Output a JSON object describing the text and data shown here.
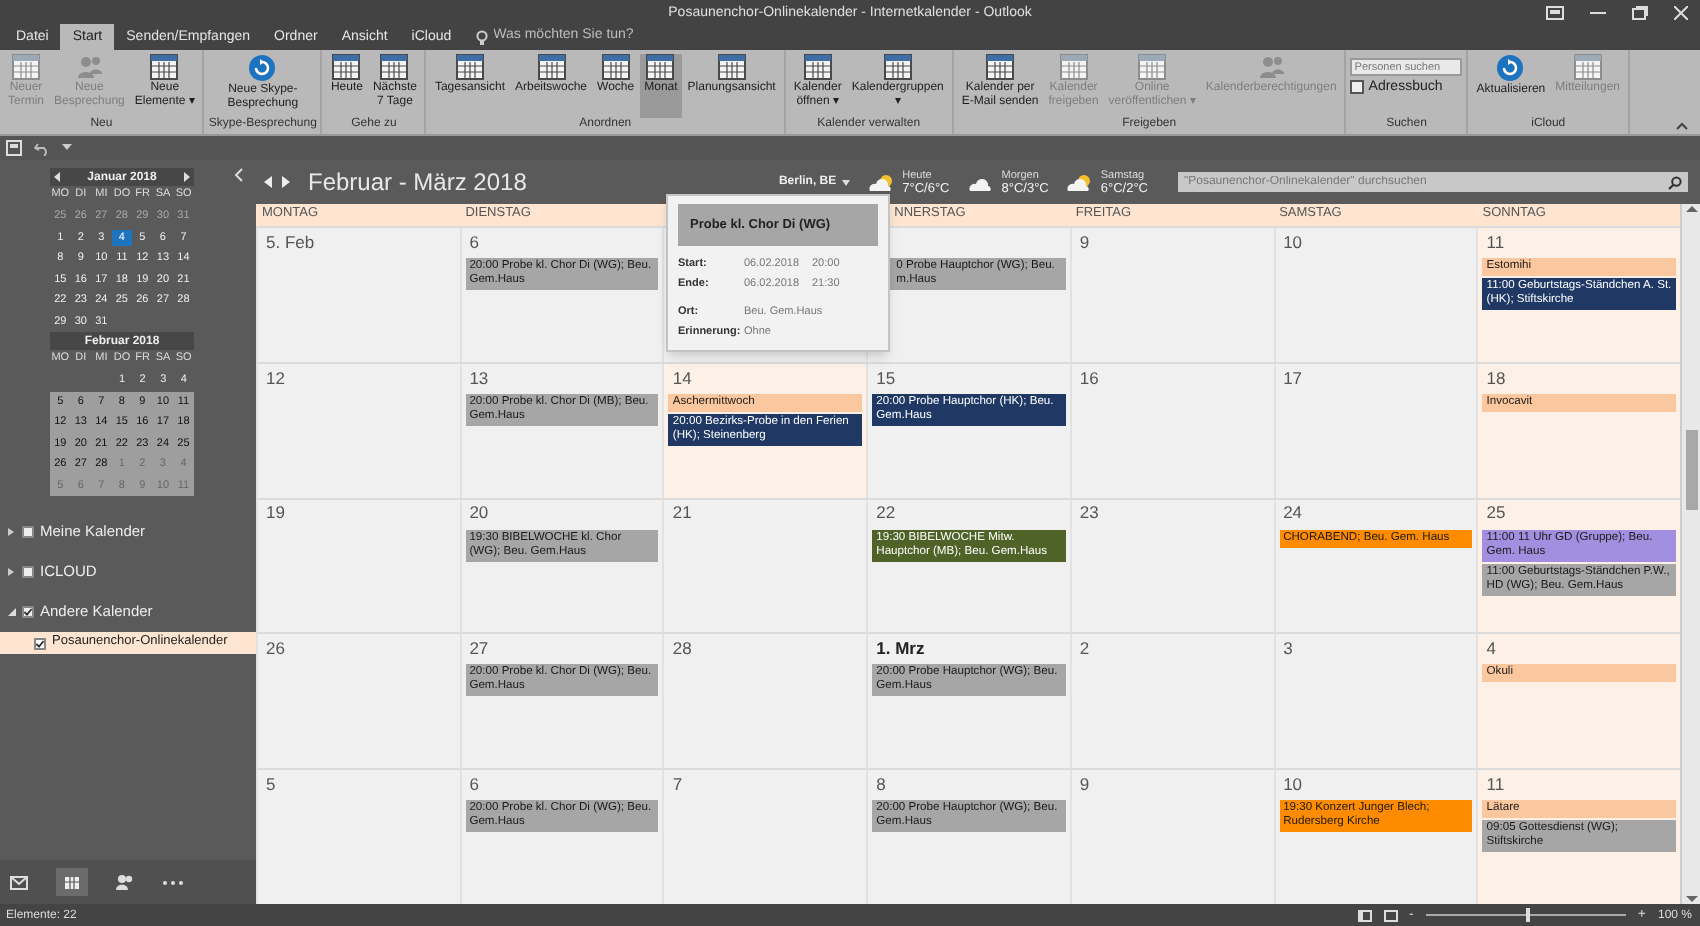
{
  "window": {
    "title": "Posaunenchor-Onlinekalender - Internetkalender - Outlook"
  },
  "tabs": [
    {
      "label": "Datei",
      "selected": false
    },
    {
      "label": "Start",
      "selected": true
    },
    {
      "label": "Senden/Empfangen",
      "selected": false
    },
    {
      "label": "Ordner",
      "selected": false
    },
    {
      "label": "Ansicht",
      "selected": false
    },
    {
      "label": "iCloud",
      "selected": false
    }
  ],
  "tell_me": {
    "placeholder": "Was möchten Sie tun?"
  },
  "ribbon": [
    {
      "group": "Neu",
      "buttons": [
        {
          "label": "Neuer\nTermin",
          "kind": "grid",
          "disabled": true,
          "selected": false
        },
        {
          "label": "Neue\nBesprechung",
          "kind": "people",
          "disabled": true,
          "selected": false
        },
        {
          "label": "Neue\nElemente ▾",
          "kind": "grid",
          "disabled": false,
          "selected": false
        }
      ]
    },
    {
      "group": "Skype-Besprechung",
      "buttons": [
        {
          "label": "Neue Skype-\nBesprechung",
          "kind": "round",
          "disabled": false,
          "selected": false
        }
      ]
    },
    {
      "group": "Gehe zu",
      "buttons": [
        {
          "label": "Heute",
          "kind": "grid",
          "disabled": false,
          "selected": false
        },
        {
          "label": "Nächste\n7 Tage",
          "kind": "grid",
          "disabled": false,
          "selected": false
        }
      ]
    },
    {
      "group": "Anordnen",
      "buttons": [
        {
          "label": "Tagesansicht",
          "kind": "grid",
          "disabled": false,
          "selected": false
        },
        {
          "label": "Arbeitswoche",
          "kind": "grid",
          "disabled": false,
          "selected": false
        },
        {
          "label": "Woche",
          "kind": "grid",
          "disabled": false,
          "selected": false
        },
        {
          "label": "Monat",
          "kind": "grid",
          "disabled": false,
          "selected": true
        },
        {
          "label": "Planungsansicht",
          "kind": "grid",
          "disabled": false,
          "selected": false
        }
      ]
    },
    {
      "group": "Kalender verwalten",
      "buttons": [
        {
          "label": "Kalender\nöffnen ▾",
          "kind": "grid",
          "disabled": false,
          "selected": false
        },
        {
          "label": "Kalendergruppen\n▾",
          "kind": "grid",
          "disabled": false,
          "selected": false
        }
      ]
    },
    {
      "group": "Freigeben",
      "buttons": [
        {
          "label": "Kalender per\nE-Mail senden",
          "kind": "grid",
          "disabled": false,
          "selected": false
        },
        {
          "label": "Kalender\nfreigeben",
          "kind": "grid",
          "disabled": true,
          "selected": false
        },
        {
          "label": "Online\nveröffentlichen ▾",
          "kind": "grid",
          "disabled": true,
          "selected": false
        },
        {
          "label": "Kalenderberechtigungen",
          "kind": "people",
          "disabled": true,
          "selected": false
        }
      ]
    },
    {
      "group": "Suchen",
      "buttons": [
        {
          "placeholder": "Personen suchen",
          "kind": "search"
        },
        {
          "label": "Adressbuch",
          "kind": "small",
          "disabled": false,
          "selected": false
        }
      ]
    },
    {
      "group": "iCloud",
      "buttons": [
        {
          "label": "Aktualisieren",
          "kind": "round",
          "disabled": false,
          "selected": false
        },
        {
          "label": "Mitteilungen",
          "kind": "grid",
          "disabled": true,
          "selected": false
        }
      ]
    }
  ],
  "mini_calendars": [
    {
      "title": "Januar 2018",
      "weekdays": [
        "MO",
        "DI",
        "MI",
        "DO",
        "FR",
        "SA",
        "SO"
      ],
      "weeks": [
        {
          "shaded": false,
          "days": [
            {
              "n": "25",
              "outside": true,
              "today": false
            },
            {
              "n": "26",
              "outside": true,
              "today": false
            },
            {
              "n": "27",
              "outside": true,
              "today": false
            },
            {
              "n": "28",
              "outside": true,
              "today": false
            },
            {
              "n": "29",
              "outside": true,
              "today": false
            },
            {
              "n": "30",
              "outside": true,
              "today": false
            },
            {
              "n": "31",
              "outside": true,
              "today": false
            }
          ]
        },
        {
          "shaded": false,
          "days": [
            {
              "n": "1",
              "outside": false,
              "today": false
            },
            {
              "n": "2",
              "outside": false,
              "today": false
            },
            {
              "n": "3",
              "outside": false,
              "today": false
            },
            {
              "n": "4",
              "outside": false,
              "today": true
            },
            {
              "n": "5",
              "outside": false,
              "today": false
            },
            {
              "n": "6",
              "outside": false,
              "today": false
            },
            {
              "n": "7",
              "outside": false,
              "today": false
            }
          ]
        },
        {
          "shaded": false,
          "days": [
            {
              "n": "8",
              "outside": false,
              "today": false
            },
            {
              "n": "9",
              "outside": false,
              "today": false
            },
            {
              "n": "10",
              "outside": false,
              "today": false
            },
            {
              "n": "11",
              "outside": false,
              "today": false
            },
            {
              "n": "12",
              "outside": false,
              "today": false
            },
            {
              "n": "13",
              "outside": false,
              "today": false
            },
            {
              "n": "14",
              "outside": false,
              "today": false
            }
          ]
        },
        {
          "shaded": false,
          "days": [
            {
              "n": "15",
              "outside": false,
              "today": false
            },
            {
              "n": "16",
              "outside": false,
              "today": false
            },
            {
              "n": "17",
              "outside": false,
              "today": false
            },
            {
              "n": "18",
              "outside": false,
              "today": false
            },
            {
              "n": "19",
              "outside": false,
              "today": false
            },
            {
              "n": "20",
              "outside": false,
              "today": false
            },
            {
              "n": "21",
              "outside": false,
              "today": false
            }
          ]
        },
        {
          "shaded": false,
          "days": [
            {
              "n": "22",
              "outside": false,
              "today": false
            },
            {
              "n": "23",
              "outside": false,
              "today": false
            },
            {
              "n": "24",
              "outside": false,
              "today": false
            },
            {
              "n": "25",
              "outside": false,
              "today": false
            },
            {
              "n": "26",
              "outside": false,
              "today": false
            },
            {
              "n": "27",
              "outside": false,
              "today": false
            },
            {
              "n": "28",
              "outside": false,
              "today": false
            }
          ]
        },
        {
          "shaded": false,
          "days": [
            {
              "n": "29",
              "outside": false,
              "today": false
            },
            {
              "n": "30",
              "outside": false,
              "today": false
            },
            {
              "n": "31",
              "outside": false,
              "today": false
            }
          ]
        }
      ]
    },
    {
      "title": "Februar 2018",
      "weekdays": [
        "MO",
        "DI",
        "MI",
        "DO",
        "FR",
        "SA",
        "SO"
      ],
      "weeks": [
        {
          "shaded": false,
          "days": [
            {
              "n": "1",
              "outside": false,
              "today": false
            },
            {
              "n": "2",
              "outside": false,
              "today": false
            },
            {
              "n": "3",
              "outside": false,
              "today": false
            },
            {
              "n": "4",
              "outside": false,
              "today": false
            }
          ]
        },
        {
          "shaded": true,
          "days": [
            {
              "n": "5",
              "outside": false,
              "today": false
            },
            {
              "n": "6",
              "outside": false,
              "today": false
            },
            {
              "n": "7",
              "outside": false,
              "today": false
            },
            {
              "n": "8",
              "outside": false,
              "today": false
            },
            {
              "n": "9",
              "outside": false,
              "today": false
            },
            {
              "n": "10",
              "outside": false,
              "today": false
            },
            {
              "n": "11",
              "outside": false,
              "today": false
            }
          ]
        },
        {
          "shaded": true,
          "days": [
            {
              "n": "12",
              "outside": false,
              "today": false
            },
            {
              "n": "13",
              "outside": false,
              "today": false
            },
            {
              "n": "14",
              "outside": false,
              "today": false
            },
            {
              "n": "15",
              "outside": false,
              "today": false
            },
            {
              "n": "16",
              "outside": false,
              "today": false
            },
            {
              "n": "17",
              "outside": false,
              "today": false
            },
            {
              "n": "18",
              "outside": false,
              "today": false
            }
          ]
        },
        {
          "shaded": true,
          "days": [
            {
              "n": "19",
              "outside": false,
              "today": false
            },
            {
              "n": "20",
              "outside": false,
              "today": false
            },
            {
              "n": "21",
              "outside": false,
              "today": false
            },
            {
              "n": "22",
              "outside": false,
              "today": false
            },
            {
              "n": "23",
              "outside": false,
              "today": false
            },
            {
              "n": "24",
              "outside": false,
              "today": false
            },
            {
              "n": "25",
              "outside": false,
              "today": false
            }
          ]
        },
        {
          "shaded": true,
          "days": [
            {
              "n": "26",
              "outside": false,
              "today": false
            },
            {
              "n": "27",
              "outside": false,
              "today": false
            },
            {
              "n": "28",
              "outside": false,
              "today": false
            },
            {
              "n": "1",
              "outside": true,
              "today": false
            },
            {
              "n": "2",
              "outside": true,
              "today": false
            },
            {
              "n": "3",
              "outside": true,
              "today": false
            },
            {
              "n": "4",
              "outside": true,
              "today": false
            }
          ]
        },
        {
          "shaded": true,
          "days": [
            {
              "n": "5",
              "outside": true,
              "today": false
            },
            {
              "n": "6",
              "outside": true,
              "today": false
            },
            {
              "n": "7",
              "outside": true,
              "today": false
            },
            {
              "n": "8",
              "outside": true,
              "today": false
            },
            {
              "n": "9",
              "outside": true,
              "today": false
            },
            {
              "n": "10",
              "outside": true,
              "today": false
            },
            {
              "n": "11",
              "outside": true,
              "today": false
            }
          ]
        }
      ]
    }
  ],
  "folders": [
    {
      "label": "Meine Kalender",
      "expanded": false,
      "checked": false
    },
    {
      "label": "ICLOUD",
      "expanded": false,
      "checked": false
    },
    {
      "label": "Andere Kalender",
      "expanded": true,
      "checked": true,
      "children": [
        {
          "label": "Posaunenchor-Onlinekalender",
          "checked": true,
          "selected": true
        }
      ]
    }
  ],
  "calendar": {
    "title": "Februar - März 2018",
    "location": "Berlin, BE",
    "weather": [
      {
        "label": "Heute",
        "temps": "7°C/6°C"
      },
      {
        "label": "Morgen",
        "temps": "8°C/3°C"
      },
      {
        "label": "Samstag",
        "temps": "6°C/2°C"
      }
    ],
    "search": {
      "placeholder": "\"Posaunenchor-Onlinekalender\" durchsuchen"
    },
    "headers": [
      {
        "label": "MONTAG"
      },
      {
        "label": "DIENSTAG"
      },
      {
        "label": "NNERSTAG",
        "partly_covered": true
      },
      {
        "label": "FREITAG"
      },
      {
        "label": "SAMSTAG"
      },
      {
        "label": "SONNTAG"
      }
    ],
    "weeks": [
      [
        {
          "date": "5. Feb",
          "holiday": false,
          "bold": false
        },
        {
          "date": "6",
          "holiday": false,
          "bold": false,
          "events": [
            {
              "text": "20:00 Probe kl. Chor Di  (WG); Beu. Gem.Haus",
              "color": "#a6a6a6"
            }
          ]
        },
        {
          "holiday": false
        },
        {
          "holiday": false,
          "events": [
            {
              "text": "0 Probe Hauptchor (WG); Beu. m.Haus",
              "color": "#a6a6a6",
              "partly_covered": true
            }
          ]
        },
        {
          "date": "9",
          "holiday": false,
          "bold": false
        },
        {
          "date": "10",
          "holiday": false,
          "bold": false
        },
        {
          "date": "11",
          "holiday": true,
          "bold": false,
          "events": [
            {
              "text": "Estomihi",
              "color": "#fbc79e"
            },
            {
              "text": "11:00 Geburtstags-Ständchen A. St. (HK); Stiftskirche",
              "color": "#1f3864"
            }
          ]
        }
      ],
      [
        {
          "date": "12",
          "holiday": false,
          "bold": false
        },
        {
          "date": "13",
          "holiday": false,
          "bold": false,
          "events": [
            {
              "text": "20:00 Probe kl. Chor Di  (MB); Beu. Gem.Haus",
              "color": "#a6a6a6"
            }
          ]
        },
        {
          "date": "14",
          "holiday": true,
          "bold": false,
          "events": [
            {
              "text": "Aschermittwoch",
              "color": "#fbc79e"
            },
            {
              "text": "20:00 Bezirks-Probe in den Ferien (HK); Steinenberg",
              "color": "#1f3864"
            }
          ]
        },
        {
          "date": "15",
          "holiday": false,
          "bold": false,
          "events": [
            {
              "text": "20:00 Probe Hauptchor (HK); Beu. Gem.Haus",
              "color": "#1f3864"
            }
          ]
        },
        {
          "date": "16",
          "holiday": false,
          "bold": false
        },
        {
          "date": "17",
          "holiday": false,
          "bold": false
        },
        {
          "date": "18",
          "holiday": true,
          "bold": false,
          "events": [
            {
              "text": "Invocavit",
              "color": "#fbc79e"
            }
          ]
        }
      ],
      [
        {
          "date": "19",
          "holiday": false,
          "bold": false
        },
        {
          "date": "20",
          "holiday": false,
          "bold": false,
          "events": [
            {
              "text": "19:30 BIBELWOCHE kl. Chor (WG); Beu. Gem.Haus",
              "color": "#a6a6a6"
            }
          ]
        },
        {
          "date": "21",
          "holiday": false,
          "bold": false
        },
        {
          "date": "22",
          "holiday": false,
          "bold": false,
          "events": [
            {
              "text": "19:30 BIBELWOCHE Mitw. Hauptchor (MB); Beu. Gem.Haus",
              "color": "#4f6228"
            }
          ]
        },
        {
          "date": "23",
          "holiday": false,
          "bold": false
        },
        {
          "date": "24",
          "holiday": false,
          "bold": false,
          "events": [
            {
              "text": "CHORABEND; Beu. Gem. Haus",
              "color": "#ff8c00"
            }
          ]
        },
        {
          "date": "25",
          "holiday": true,
          "bold": false,
          "events": [
            {
              "text": "11:00 11 Uhr GD (Gruppe); Beu. Gem. Haus",
              "color": "#a38fe0"
            },
            {
              "text": "11:00 Geburtstags-Ständchen P.W., HD (WG); Beu. Gem.Haus",
              "color": "#a6a6a6"
            }
          ]
        }
      ],
      [
        {
          "date": "26",
          "holiday": false,
          "bold": false
        },
        {
          "date": "27",
          "holiday": false,
          "bold": false,
          "events": [
            {
              "text": "20:00 Probe kl. Chor Di  (WG); Beu. Gem.Haus",
              "color": "#a6a6a6"
            }
          ]
        },
        {
          "date": "28",
          "holiday": false,
          "bold": false
        },
        {
          "date": "1. Mrz",
          "holiday": false,
          "bold": true,
          "events": [
            {
              "text": "20:00 Probe Hauptchor (WG); Beu. Gem.Haus",
              "color": "#a6a6a6"
            }
          ]
        },
        {
          "date": "2",
          "holiday": false,
          "bold": false
        },
        {
          "date": "3",
          "holiday": false,
          "bold": false
        },
        {
          "date": "4",
          "holiday": true,
          "bold": false,
          "events": [
            {
              "text": "Okuli",
              "color": "#fbc79e"
            }
          ]
        }
      ],
      [
        {
          "date": "5",
          "holiday": false,
          "bold": false
        },
        {
          "date": "6",
          "holiday": false,
          "bold": false,
          "events": [
            {
              "text": "20:00 Probe kl. Chor Di  (WG); Beu. Gem.Haus",
              "color": "#a6a6a6"
            }
          ]
        },
        {
          "date": "7",
          "holiday": false,
          "bold": false
        },
        {
          "date": "8",
          "holiday": false,
          "bold": false,
          "events": [
            {
              "text": "20:00 Probe Hauptchor (WG); Beu. Gem.Haus",
              "color": "#a6a6a6"
            }
          ]
        },
        {
          "date": "9",
          "holiday": false,
          "bold": false
        },
        {
          "date": "10",
          "holiday": false,
          "bold": false,
          "events": [
            {
              "text": "19:30 Konzert Junger Blech; Rudersberg Kirche",
              "color": "#ff8c00"
            }
          ]
        },
        {
          "date": "11",
          "holiday": true,
          "bold": false,
          "events": [
            {
              "text": "Lätare",
              "color": "#fbc79e"
            },
            {
              "text": "09:05 Gottesdienst (WG); Stiftskirche",
              "color": "#a6a6a6"
            }
          ]
        }
      ]
    ]
  },
  "popup": {
    "title": "Probe kl. Chor Di  (WG)",
    "rows": [
      {
        "label": "Start:",
        "values": [
          "06.02.2018",
          "20:00"
        ]
      },
      {
        "label": "Ende:",
        "values": [
          "06.02.2018",
          "21:30"
        ]
      },
      {
        "label": "Ort:",
        "values": [
          "Beu. Gem.Haus"
        ]
      },
      {
        "label": "Erinnerung:",
        "values": [
          "Ohne"
        ]
      }
    ]
  },
  "status_bar": {
    "items": "Elemente: 22",
    "zoom_out": "-",
    "zoom_in": "+",
    "zoom": "100 %",
    "level": 0.5
  }
}
